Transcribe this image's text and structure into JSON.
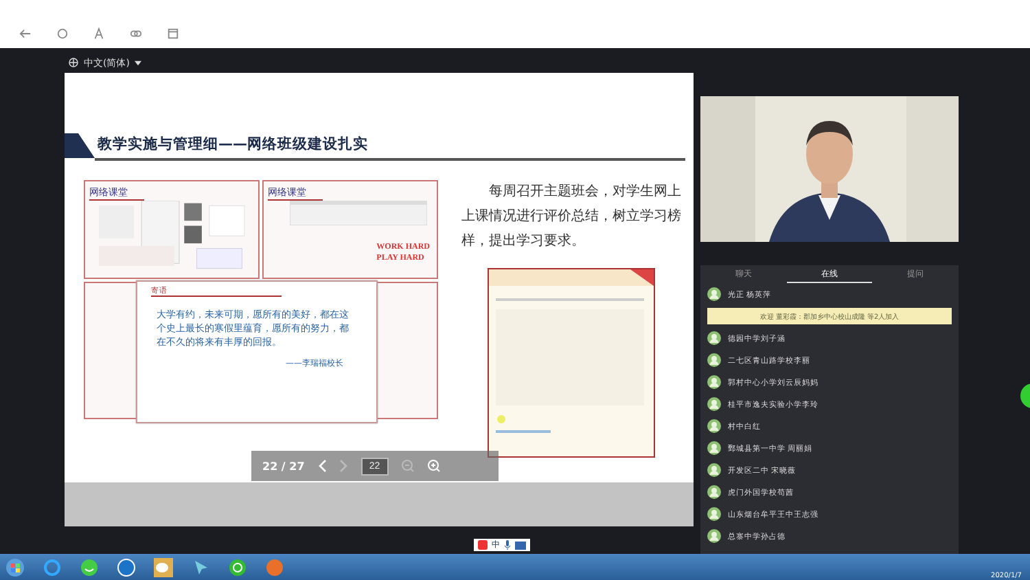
{
  "language": "中文(简体)",
  "slide": {
    "title": "教学实施与管理细——网络班级建设扎实",
    "panels": [
      {
        "label": "网络课堂",
        "kind": "picture"
      },
      {
        "label": "网络课堂",
        "kind": "motto",
        "motto": [
          "WORK HARD",
          "PLAY HARD"
        ]
      }
    ],
    "message": {
      "heading": "寄语",
      "body": "大学有约，未来可期，愿所有的美好，都在这个史上最长的寒假里蕴育，愿所有的努力，都在不久的将来有丰厚的回报。",
      "signature": "——李瑞福校长"
    },
    "paragraph": "每周召开主题班会，对学生网上上课情况进行评价总结，树立学习榜样，提出学习要求。"
  },
  "pager": {
    "page": "22 / 27",
    "goto": "22"
  },
  "chat": {
    "tabs": [
      {
        "label": "聊天",
        "selected": false
      },
      {
        "label": "在线",
        "selected": true
      },
      {
        "label": "提问",
        "selected": false
      }
    ],
    "first": "光正 杨英萍",
    "banner": "欢迎 董彩霞：郡加乡中心校山成隆 等2人加入",
    "users": [
      "德园中学刘子涵",
      "二七区青山路学校李丽",
      "郭村中心小学刘云辰妈妈",
      "桂平市逸夫实验小学李玲",
      "村中白红",
      "鄄城县第一中学 周丽娟",
      "开发区二中 宋晓薇",
      "虎门外国学校苟茜",
      "山东烟台牟平王中王志强",
      "总寨中学孙占德"
    ]
  },
  "ime": "中",
  "date": "2020/1/7"
}
